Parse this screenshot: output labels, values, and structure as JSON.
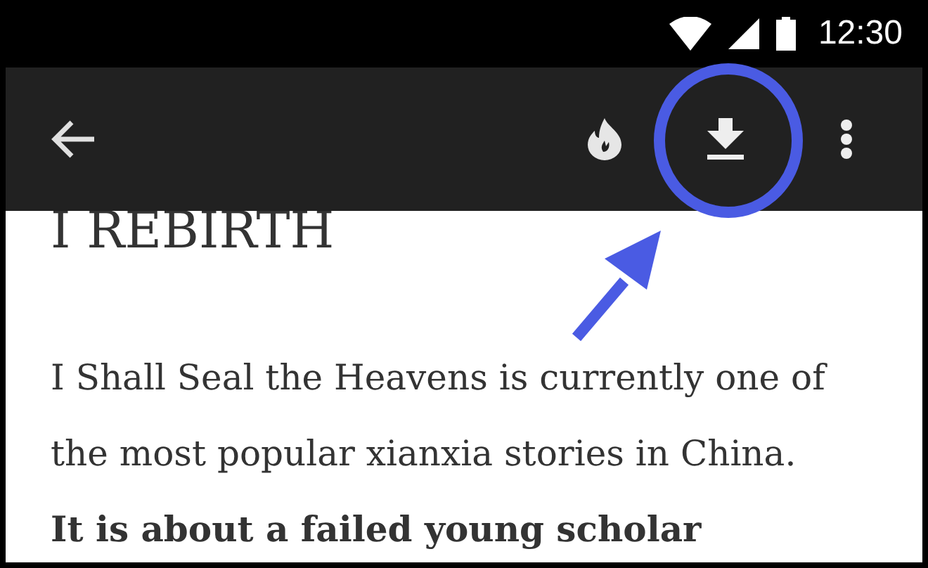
{
  "status_bar": {
    "time": "12:30"
  },
  "toolbar": {
    "download_highlighted": true
  },
  "article": {
    "heading": "I REBIRTH",
    "paragraph": "I Shall Seal the Heavens is currently one of the most popular xianxia stories in China. **It is about a failed young scholar**"
  }
}
